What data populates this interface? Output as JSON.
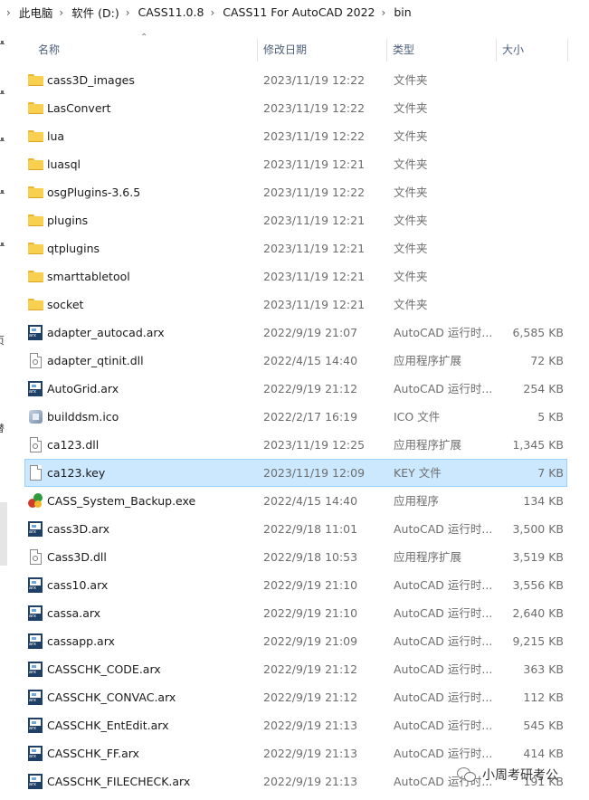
{
  "breadcrumb": [
    "此电脑",
    "软件 (D:)",
    "CASS11.0.8",
    "CASS11 For AutoCAD 2022",
    "bin"
  ],
  "left_edge_chars": [
    "页",
    "替"
  ],
  "columns": {
    "name": "名称",
    "date": "修改日期",
    "type": "类型",
    "size": "大小"
  },
  "files": [
    {
      "name": "cass3D_images",
      "date": "2023/11/19 12:22",
      "type": "文件夹",
      "size": "",
      "icon": "folder-icon"
    },
    {
      "name": "LasConvert",
      "date": "2023/11/19 12:22",
      "type": "文件夹",
      "size": "",
      "icon": "folder-icon"
    },
    {
      "name": "lua",
      "date": "2023/11/19 12:22",
      "type": "文件夹",
      "size": "",
      "icon": "folder-icon"
    },
    {
      "name": "luasql",
      "date": "2023/11/19 12:21",
      "type": "文件夹",
      "size": "",
      "icon": "folder-icon"
    },
    {
      "name": "osgPlugins-3.6.5",
      "date": "2023/11/19 12:22",
      "type": "文件夹",
      "size": "",
      "icon": "folder-icon"
    },
    {
      "name": "plugins",
      "date": "2023/11/19 12:21",
      "type": "文件夹",
      "size": "",
      "icon": "folder-icon"
    },
    {
      "name": "qtplugins",
      "date": "2023/11/19 12:21",
      "type": "文件夹",
      "size": "",
      "icon": "folder-icon"
    },
    {
      "name": "smarttabletool",
      "date": "2023/11/19 12:21",
      "type": "文件夹",
      "size": "",
      "icon": "folder-icon"
    },
    {
      "name": "socket",
      "date": "2023/11/19 12:21",
      "type": "文件夹",
      "size": "",
      "icon": "folder-icon"
    },
    {
      "name": "adapter_autocad.arx",
      "date": "2022/9/19 21:07",
      "type": "AutoCAD 运行时...",
      "size": "6,585 KB",
      "icon": "arx-file-icon"
    },
    {
      "name": "adapter_qtinit.dll",
      "date": "2022/4/15 14:40",
      "type": "应用程序扩展",
      "size": "72 KB",
      "icon": "dll-file-icon"
    },
    {
      "name": "AutoGrid.arx",
      "date": "2022/9/19 21:12",
      "type": "AutoCAD 运行时...",
      "size": "254 KB",
      "icon": "arx-file-icon"
    },
    {
      "name": "builddsm.ico",
      "date": "2022/2/17 16:19",
      "type": "ICO 文件",
      "size": "5 KB",
      "icon": "ico-file-icon"
    },
    {
      "name": "ca123.dll",
      "date": "2023/11/19 12:25",
      "type": "应用程序扩展",
      "size": "1,345 KB",
      "icon": "dll-file-icon"
    },
    {
      "name": "ca123.key",
      "date": "2023/11/19 12:09",
      "type": "KEY 文件",
      "size": "7 KB",
      "icon": "blank-file-icon",
      "selected": true
    },
    {
      "name": "CASS_System_Backup.exe",
      "date": "2022/4/15 14:40",
      "type": "应用程序",
      "size": "134 KB",
      "icon": "exe-file-icon"
    },
    {
      "name": "cass3D.arx",
      "date": "2022/9/18 11:01",
      "type": "AutoCAD 运行时...",
      "size": "3,500 KB",
      "icon": "arx-file-icon"
    },
    {
      "name": "Cass3D.dll",
      "date": "2022/9/18 10:53",
      "type": "应用程序扩展",
      "size": "3,519 KB",
      "icon": "dll-file-icon"
    },
    {
      "name": "cass10.arx",
      "date": "2022/9/19 21:10",
      "type": "AutoCAD 运行时...",
      "size": "3,556 KB",
      "icon": "arx-file-icon"
    },
    {
      "name": "cassa.arx",
      "date": "2022/9/19 21:10",
      "type": "AutoCAD 运行时...",
      "size": "2,640 KB",
      "icon": "arx-file-icon"
    },
    {
      "name": "cassapp.arx",
      "date": "2022/9/19 21:09",
      "type": "AutoCAD 运行时...",
      "size": "9,215 KB",
      "icon": "arx-file-icon"
    },
    {
      "name": "CASSCHK_CODE.arx",
      "date": "2022/9/19 21:12",
      "type": "AutoCAD 运行时...",
      "size": "363 KB",
      "icon": "arx-file-icon"
    },
    {
      "name": "CASSCHK_CONVAC.arx",
      "date": "2022/9/19 21:12",
      "type": "AutoCAD 运行时...",
      "size": "112 KB",
      "icon": "arx-file-icon"
    },
    {
      "name": "CASSCHK_EntEdit.arx",
      "date": "2022/9/19 21:13",
      "type": "AutoCAD 运行时...",
      "size": "545 KB",
      "icon": "arx-file-icon"
    },
    {
      "name": "CASSCHK_FF.arx",
      "date": "2022/9/19 21:13",
      "type": "AutoCAD 运行时...",
      "size": "414 KB",
      "icon": "arx-file-icon"
    },
    {
      "name": "CASSCHK_FILECHECK.arx",
      "date": "2022/9/19 21:13",
      "type": "AutoCAD 运行时...",
      "size": "191 KB",
      "icon": "arx-file-icon"
    }
  ],
  "watermark": {
    "text": "小周考研考公",
    "icon": "wechat-icon"
  },
  "colors": {
    "selected_bg": "#cce8ff",
    "selected_border": "#99d1ff",
    "folder": "#f8cf4e",
    "header_text": "#4c607a"
  }
}
